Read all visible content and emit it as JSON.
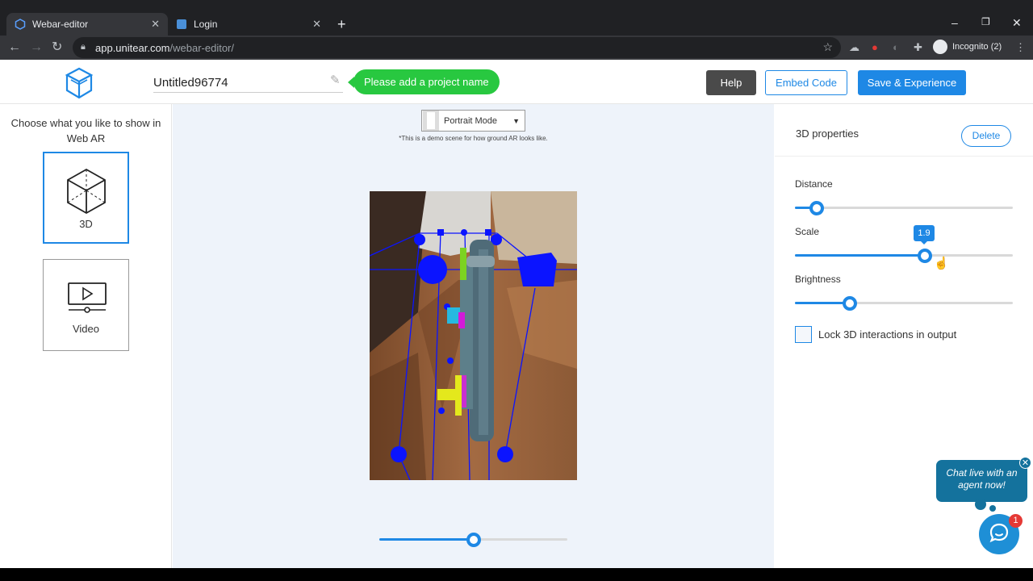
{
  "browser": {
    "tabs": [
      {
        "title": "Webar-editor",
        "active": true
      },
      {
        "title": "Login",
        "active": false
      }
    ],
    "url_host": "app.unitear.com",
    "url_path": "/webar-editor/",
    "profile_label": "Incognito (2)"
  },
  "header": {
    "project_name_value": "Untitled96774",
    "project_hint": "Please add a project name",
    "help_label": "Help",
    "embed_label": "Embed Code",
    "save_label": "Save & Experience"
  },
  "left_panel": {
    "title": "Choose what you like to show in Web AR",
    "options": [
      {
        "label": "3D",
        "icon": "cube-icon",
        "selected": true
      },
      {
        "label": "Video",
        "icon": "video-icon",
        "selected": false
      }
    ]
  },
  "canvas": {
    "mode_select": "Portrait Mode",
    "demo_note": "*This is a demo scene for how ground AR looks like.",
    "bottom_slider_level": 0.5
  },
  "properties": {
    "title": "3D properties",
    "delete_label": "Delete",
    "distance": {
      "label": "Distance",
      "level": 0.1
    },
    "scale": {
      "label": "Scale",
      "value_label": "1.9",
      "level": 0.595
    },
    "brightness": {
      "label": "Brightness",
      "level": 0.25
    },
    "lock_label": "Lock 3D interactions in output",
    "lock_checked": false
  },
  "chat": {
    "bubble_text": "Chat live with an agent now!",
    "badge_count": "1"
  },
  "colors": {
    "accent": "#1e88e5",
    "hint_green": "#28c840",
    "chat_blue": "#14729d"
  }
}
